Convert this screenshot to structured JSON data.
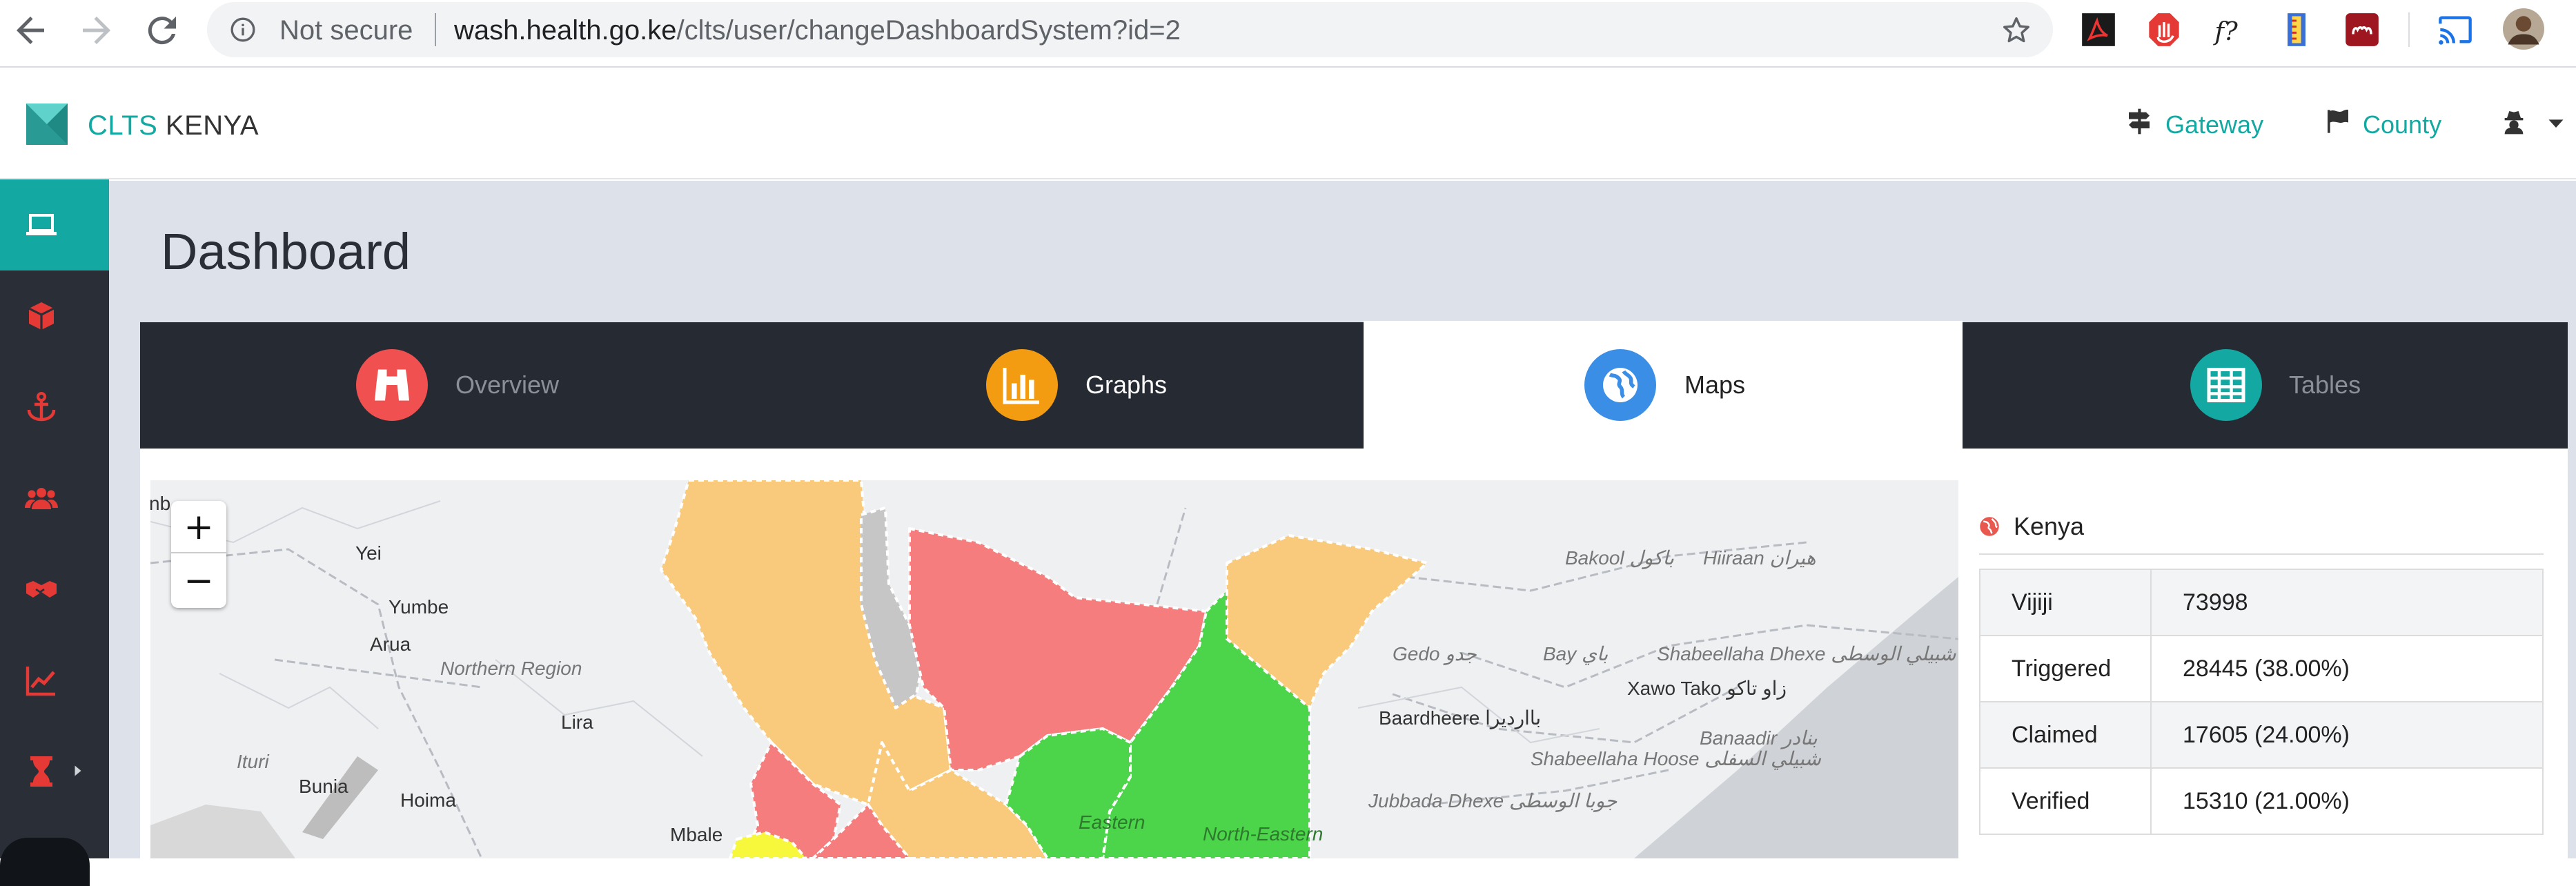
{
  "browser": {
    "security_label": "Not secure",
    "url_host": "wash.health.go.ke",
    "url_path": "/clts/user/changeDashboardSystem?id=2",
    "extension_icons": [
      "pdf-icon",
      "adblock-icon",
      "font-finder-icon",
      "ruler-icon",
      "mendeley-icon",
      "cast-icon",
      "profile-avatar"
    ]
  },
  "navbar": {
    "brand_accent": "CLTS",
    "brand_rest": " KENYA",
    "links": [
      {
        "label": "Gateway",
        "icon": "signpost-icon"
      },
      {
        "label": "County",
        "icon": "flag-icon"
      }
    ],
    "user_icon": "user-secret-icon"
  },
  "sidebar": {
    "items": [
      {
        "icon": "laptop-icon",
        "active": true
      },
      {
        "icon": "cube-icon"
      },
      {
        "icon": "anchor-icon"
      },
      {
        "icon": "users-icon"
      },
      {
        "icon": "handshake-icon"
      },
      {
        "icon": "line-chart-icon"
      },
      {
        "icon": "hourglass-icon",
        "has_submenu": true
      }
    ]
  },
  "page": {
    "title": "Dashboard"
  },
  "tabs": [
    {
      "label": "Overview",
      "icon": "binoculars-icon",
      "color": "#f0504f"
    },
    {
      "label": "Graphs",
      "icon": "bar-chart-icon",
      "color": "#f39c12"
    },
    {
      "label": "Maps",
      "icon": "globe-icon",
      "color": "#3a8ee6",
      "active": true
    },
    {
      "label": "Tables",
      "icon": "table-icon",
      "color": "#14a8a2"
    }
  ],
  "map": {
    "zoom_in": "+",
    "zoom_out": "−",
    "labels": {
      "edge": "nb",
      "yei": "Yei",
      "yumbe": "Yumbe",
      "arua": "Arua",
      "northern_region": "Northern Region",
      "lira": "Lira",
      "ituri": "Ituri",
      "bunia": "Bunia",
      "hoima": "Hoima",
      "mbale": "Mbale",
      "eastern": "Eastern",
      "north_eastern": "North-Eastern",
      "bakool": "Bakool باكول",
      "hiiraan": "Hiiraan هيران",
      "gedo": "Gedo جدو",
      "bay": "Bay باي",
      "shabeellaha_dhexe": "Shabeellaha Dhexe شبيلي الوسطى",
      "xawo_tako": "Xawo Tako زاو تاكو",
      "baardheere": "Baardheere باارديرا",
      "banaadir": "Banaadir بنادر",
      "shabeellaha_hoose": "Shabeellaha Hoose شبيلي السفلى",
      "jubbada_dhexe": "Jubbada Dhexe جوبا الوسطى"
    },
    "colors": {
      "red": "#f67d7d",
      "orange": "#f9c97c",
      "green": "#4cd44a",
      "yellow": "#f7f73b",
      "grey": "#c6c6c6"
    }
  },
  "panel": {
    "title": "Kenya",
    "rows": [
      {
        "key": "Vijiji",
        "value": "73998"
      },
      {
        "key": "Triggered",
        "value": "28445 (38.00%)"
      },
      {
        "key": "Claimed",
        "value": "17605 (24.00%)"
      },
      {
        "key": "Verified",
        "value": "15310 (21.00%)"
      }
    ]
  }
}
